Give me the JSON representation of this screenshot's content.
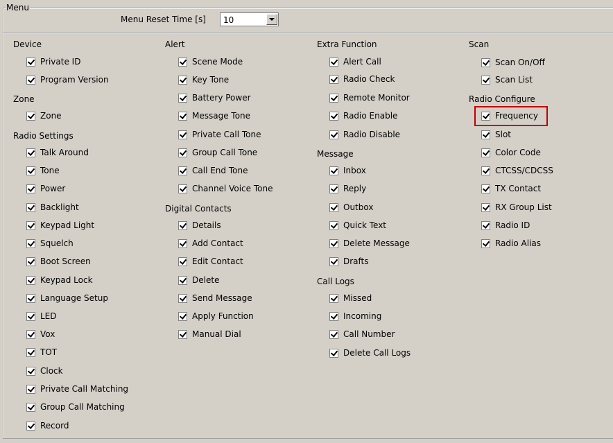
{
  "group_title": "Menu",
  "reset": {
    "label": "Menu Reset Time [s]",
    "value": "10"
  },
  "columns": [
    {
      "sections": [
        {
          "title": "Device",
          "items": [
            "Private ID",
            "Program Version"
          ]
        },
        {
          "title": "Zone",
          "items": [
            "Zone"
          ]
        },
        {
          "title": "Radio Settings",
          "items": [
            "Talk Around",
            "Tone",
            "Power",
            "Backlight",
            "Keypad Light",
            "Squelch",
            "Boot Screen",
            "Keypad Lock",
            "Language Setup",
            "LED",
            "Vox",
            "TOT",
            "Clock",
            "Private Call Matching",
            "Group Call Matching",
            "Record"
          ]
        }
      ]
    },
    {
      "sections": [
        {
          "title": "Alert",
          "items": [
            "Scene Mode",
            "Key Tone",
            "Battery Power",
            "Message Tone",
            "Private Call Tone",
            "Group Call Tone",
            "Call End Tone",
            "Channel Voice Tone"
          ]
        },
        {
          "title": "Digital Contacts",
          "items": [
            "Details",
            "Add Contact",
            "Edit Contact",
            "Delete",
            "Send Message",
            "Apply Function",
            "Manual Dial"
          ]
        }
      ]
    },
    {
      "sections": [
        {
          "title": "Extra Function",
          "items": [
            "Alert Call",
            "Radio Check",
            "Remote Monitor",
            "Radio Enable",
            "Radio Disable"
          ]
        },
        {
          "title": "Message",
          "items": [
            "Inbox",
            "Reply",
            "Outbox",
            "Quick Text",
            "Delete Message",
            "Drafts"
          ]
        },
        {
          "title": "Call Logs",
          "items": [
            "Missed",
            "Incoming",
            "Call Number",
            "Delete Call Logs"
          ]
        }
      ]
    },
    {
      "sections": [
        {
          "title": "Scan",
          "items": [
            "Scan On/Off",
            "Scan List"
          ]
        },
        {
          "title": "Radio Configure",
          "items": [
            "Frequency",
            "Slot",
            "Color Code",
            "CTCSS/CDCSS",
            "TX Contact",
            "RX Group List",
            "Radio ID",
            "Radio Alias"
          ]
        }
      ]
    }
  ]
}
